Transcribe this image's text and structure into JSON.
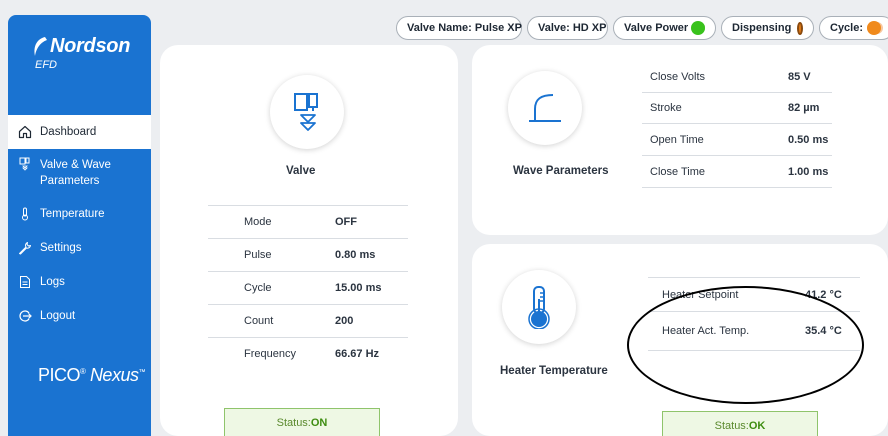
{
  "brand": {
    "name": "Nordson",
    "sub": "EFD",
    "product_main": "PICO",
    "product_reg": "®",
    "product_italic": "Nexus",
    "product_tm": "™"
  },
  "sidebar": {
    "items": [
      {
        "label": "Dashboard",
        "icon": "home-icon"
      },
      {
        "label": "Valve & Wave",
        "label2": "Parameters",
        "icon": "valve-icon"
      },
      {
        "label": "Temperature",
        "icon": "thermometer-icon"
      },
      {
        "label": "Settings",
        "icon": "wrench-icon"
      },
      {
        "label": "Logs",
        "icon": "document-icon"
      },
      {
        "label": "Logout",
        "icon": "logout-icon"
      }
    ]
  },
  "topbar": {
    "valve_name": "Valve Name: Pulse XP",
    "valve": "Valve:  HD XP",
    "valve_power": "Valve Power",
    "dispensing": "Dispensing",
    "cycle": "Cycle:"
  },
  "colors": {
    "sidebar": "#1a73d1",
    "toggle_on": "#39c21c",
    "dispensing": "#e07a16",
    "cycle": "#f08a1c",
    "status_ok": "#3e8d11"
  },
  "valve_card": {
    "title": "Valve",
    "rows": [
      {
        "key": "Mode",
        "value": "OFF"
      },
      {
        "key": "Pulse",
        "value": "0.80 ms"
      },
      {
        "key": "Cycle",
        "value": "15.00 ms"
      },
      {
        "key": "Count",
        "value": "200"
      },
      {
        "key": "Frequency",
        "value": "66.67 Hz"
      }
    ],
    "status_label": "Status:",
    "status_value": "ON"
  },
  "wave_card": {
    "title": "Wave Parameters",
    "rows": [
      {
        "key": "Close Volts",
        "value": "85 V"
      },
      {
        "key": "Stroke",
        "value": "82 µm"
      },
      {
        "key": "Open Time",
        "value": "0.50 ms"
      },
      {
        "key": "Close Time",
        "value": "1.00 ms"
      }
    ]
  },
  "heater_card": {
    "title": "Heater Temperature",
    "rows": [
      {
        "key": "Heater Setpoint",
        "value": "41.2 °C"
      },
      {
        "key": "Heater Act. Temp.",
        "value": "35.4 °C"
      }
    ],
    "status_label": "Status:",
    "status_value": "OK"
  }
}
